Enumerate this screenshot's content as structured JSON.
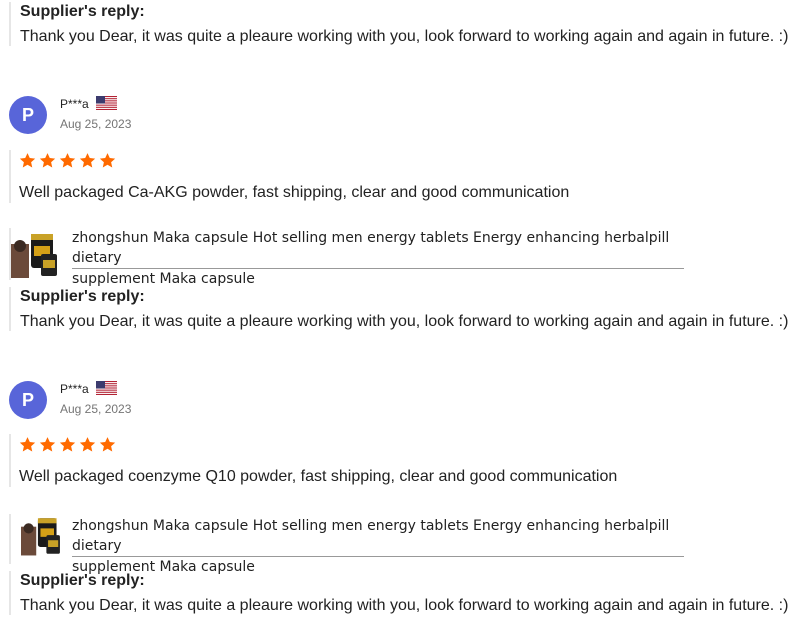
{
  "replies": [
    {
      "title": "Supplier's reply:",
      "text": "Thank you Dear, it was quite a pleaure working with you, look forward to working again and again in future. :)"
    },
    {
      "title": "Supplier's reply:",
      "text": "Thank you Dear, it was quite a pleaure working with you, look forward to working again and again in future. :)"
    },
    {
      "title": "Supplier's reply:",
      "text": "Thank you Dear, it was quite a pleaure working with you, look forward to working again and again in future. :)"
    }
  ],
  "reviews": [
    {
      "avatar_letter": "P",
      "username": "P***a",
      "flag_icon": "us-flag-icon",
      "date": "Aug 25, 2023",
      "rating": 5,
      "text": "Well packaged Ca-AKG powder, fast shipping, clear and good communication",
      "product": {
        "title_line1": "zhongshun Maka capsule Hot selling men energy tablets Energy enhancing herbalpill dietary",
        "title_line2": "supplement Maka capsule"
      }
    },
    {
      "avatar_letter": "P",
      "username": "P***a",
      "flag_icon": "us-flag-icon",
      "date": "Aug 25, 2023",
      "rating": 5,
      "text": "Well packaged coenzyme Q10 powder, fast shipping, clear and good communication",
      "product": {
        "title_line1": "zhongshun Maka capsule Hot selling men energy tablets Energy enhancing herbalpill dietary",
        "title_line2": "supplement Maka capsule"
      }
    }
  ],
  "colors": {
    "star": "#ff6a00",
    "avatar": "#5865d9",
    "date": "#757575"
  }
}
